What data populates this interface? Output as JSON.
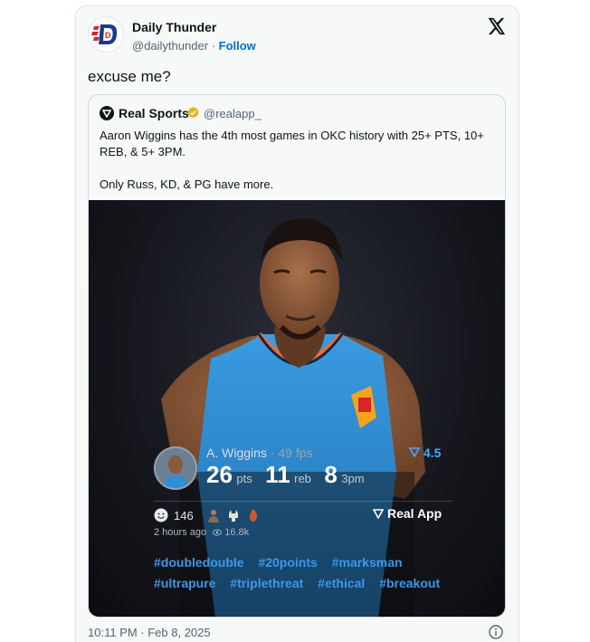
{
  "author": {
    "name": "Daily Thunder",
    "handle": "@dailythunder",
    "separator": "·",
    "follow_label": "Follow",
    "avatar_icon": "daily-thunder-logo",
    "avatar_text": "D"
  },
  "brand_icon": "x-logo-icon",
  "tweet": {
    "text": "excuse me?"
  },
  "quote": {
    "name": "Real Sports",
    "handle": "@realapp_",
    "verified_icon": "verified-badge-icon",
    "text_line1": "Aaron Wiggins has the 4th most games in OKC history with 25+ PTS, 10+ REB, & 5+ 3PM.",
    "text_line2": "Only Russ, KD, & PG have more.",
    "card": {
      "player_name": "A. Wiggins",
      "fps": "· 49 fps",
      "rating": "4.5",
      "stats": [
        {
          "value": "26",
          "unit": "pts"
        },
        {
          "value": "11",
          "unit": "reb"
        },
        {
          "value": "8",
          "unit": "3pm"
        }
      ],
      "reaction_count": "146",
      "realapp_label": "Real App",
      "posted": "2 hours ago",
      "views": "16.8k",
      "hashtags": [
        "#doubledouble",
        "#20points",
        "#marksman",
        "#ultrapure",
        "#triplethreat",
        "#ethical",
        "#breakout"
      ]
    }
  },
  "footer": {
    "date": "10:11 PM · Feb 8, 2025"
  },
  "colors": {
    "link": "#006fd6",
    "hashtag": "#3c97ec",
    "rating": "#4aa8ff",
    "jersey": "#2f8fd8"
  }
}
